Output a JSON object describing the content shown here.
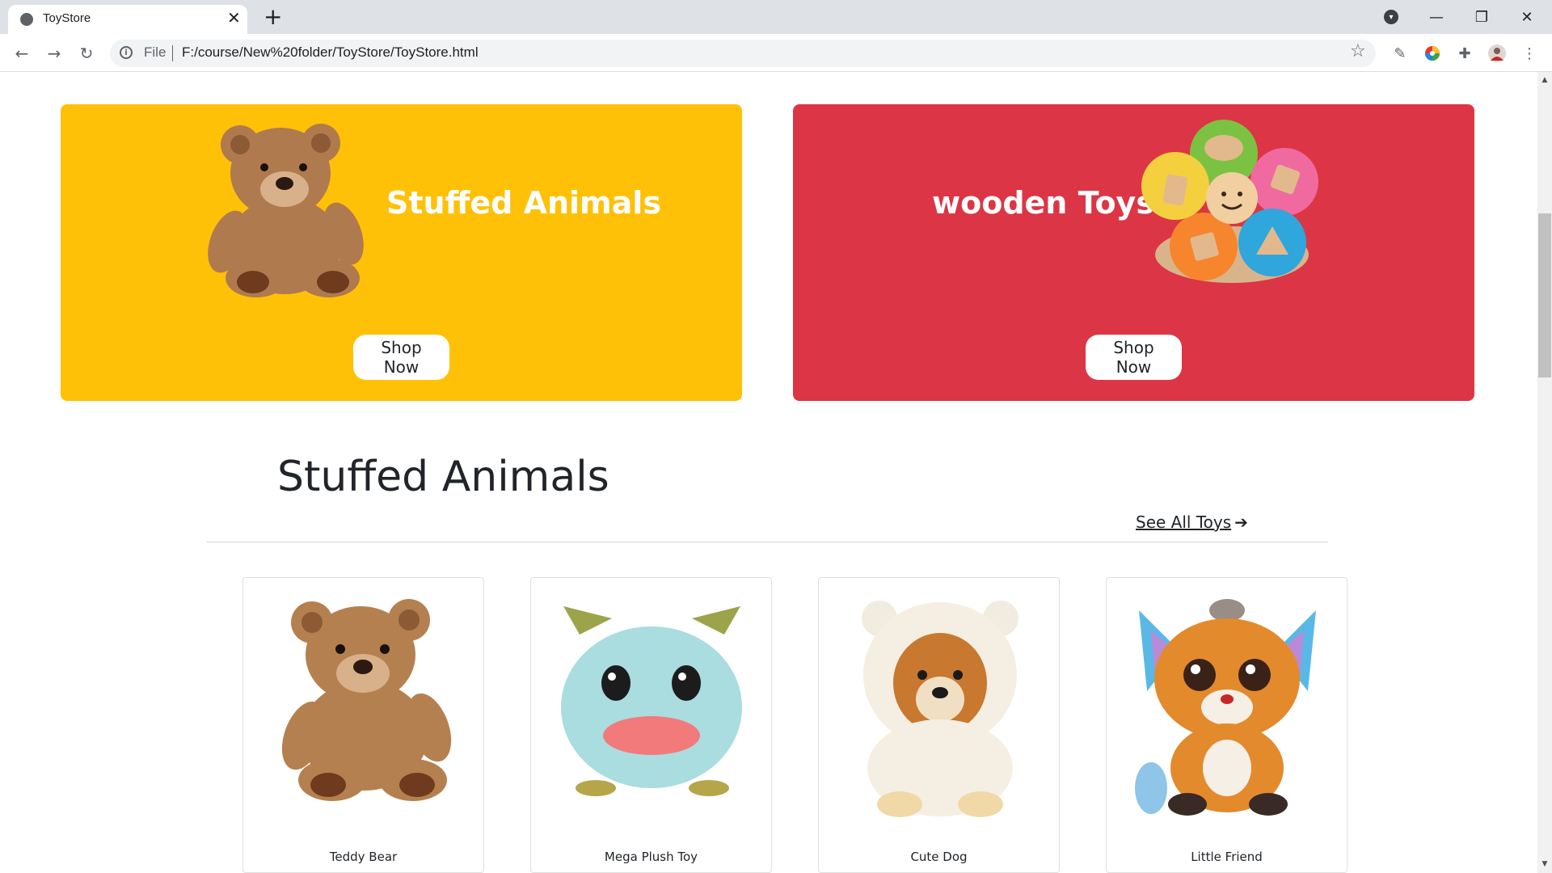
{
  "browser": {
    "tab_title": "ToyStore",
    "new_tab": "+",
    "close_tab": "✕",
    "url_scheme": "File",
    "url": "F:/course/New%20folder/ToyStore/ToyStore.html"
  },
  "banners": [
    {
      "title": "Stuffed Animals",
      "button": "Shop Now",
      "color": "#ffc107",
      "image": "teddy-bear"
    },
    {
      "title": "wooden Toys",
      "button": "Shop Now",
      "color": "#dc3545",
      "image": "wooden-flower-puzzle"
    }
  ],
  "section": {
    "title": "Stuffed Animals",
    "see_all": "See All Toys",
    "see_all_arrow": "➔"
  },
  "products": [
    {
      "name": "Teddy Bear",
      "image": "teddy-bear"
    },
    {
      "name": "Mega Plush Toy",
      "image": "blue-monster-plush"
    },
    {
      "name": "Cute Dog",
      "image": "pomeranian-in-hoodie"
    },
    {
      "name": "Little Friend",
      "image": "fox-plush"
    }
  ]
}
